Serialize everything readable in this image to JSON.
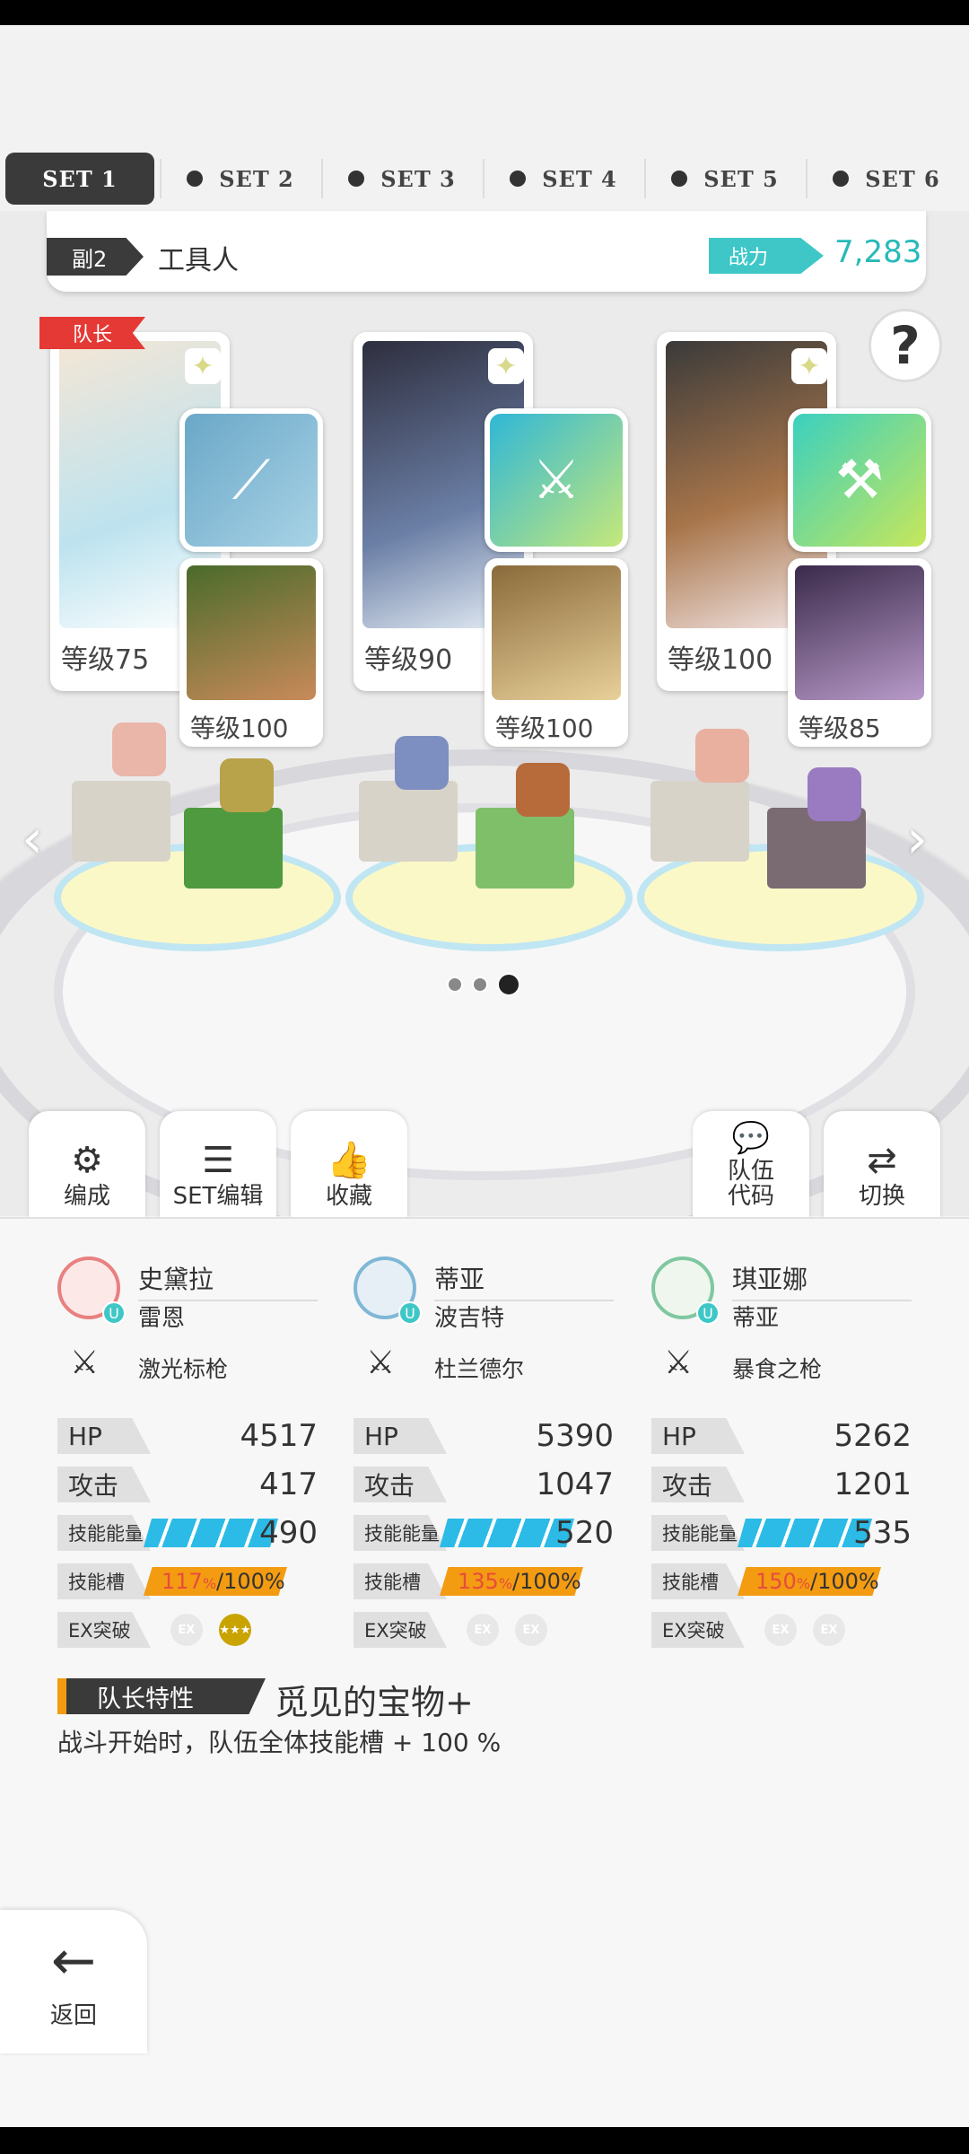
{
  "tabs": [
    {
      "label": "SET 1",
      "active": true
    },
    {
      "label": "SET 2",
      "active": false
    },
    {
      "label": "SET 3",
      "active": false
    },
    {
      "label": "SET 4",
      "active": false
    },
    {
      "label": "SET 5",
      "active": false
    },
    {
      "label": "SET 6",
      "active": false
    }
  ],
  "team": {
    "tag": "副2",
    "name": "工具人",
    "power_label": "战力",
    "power_value": "7,283"
  },
  "help_label": "?",
  "leader_badge": "队长",
  "cards": [
    {
      "level": "等级75",
      "sub_level": "等级100"
    },
    {
      "level": "等级90",
      "sub_level": "等级100"
    },
    {
      "level": "等级100",
      "sub_level": "等级85"
    }
  ],
  "actions": {
    "formation": "编成",
    "set_edit": "SET编辑",
    "favorite": "收藏",
    "team_code": "队伍\n代码",
    "switch": "切换"
  },
  "members": [
    {
      "name": "史黛拉",
      "sub": "雷恩",
      "weapon": "激光标枪",
      "hp_label": "HP",
      "hp": "4517",
      "atk_label": "攻击",
      "atk": "417",
      "energy_label": "技能能量",
      "energy": "490",
      "slot_label": "技能槽",
      "slot": "117",
      "slot_unit": "%",
      "slot_max": "/100%",
      "ex_label": "EX突破"
    },
    {
      "name": "蒂亚",
      "sub": "波吉特",
      "weapon": "杜兰德尔",
      "hp_label": "HP",
      "hp": "5390",
      "atk_label": "攻击",
      "atk": "1047",
      "energy_label": "技能能量",
      "energy": "520",
      "slot_label": "技能槽",
      "slot": "135",
      "slot_unit": "%",
      "slot_max": "/100%",
      "ex_label": "EX突破"
    },
    {
      "name": "琪亚娜",
      "sub": "蒂亚",
      "weapon": "暴食之枪",
      "hp_label": "HP",
      "hp": "5262",
      "atk_label": "攻击",
      "atk": "1201",
      "energy_label": "技能能量",
      "energy": "535",
      "slot_label": "技能槽",
      "slot": "150",
      "slot_unit": "%",
      "slot_max": "/100%",
      "ex_label": "EX突破"
    }
  ],
  "ex_badge": "EX",
  "leader_skill": {
    "tag": "队长特性",
    "name": "觅见的宝物+",
    "desc": "战斗开始时，队伍全体技能槽 + 100 %"
  },
  "back_label": "返回",
  "colors": {
    "accent_teal": "#3fc7c7",
    "energy_blue": "#2bbbe6",
    "slot_orange": "#f39c12",
    "leader_red": "#e53935"
  }
}
